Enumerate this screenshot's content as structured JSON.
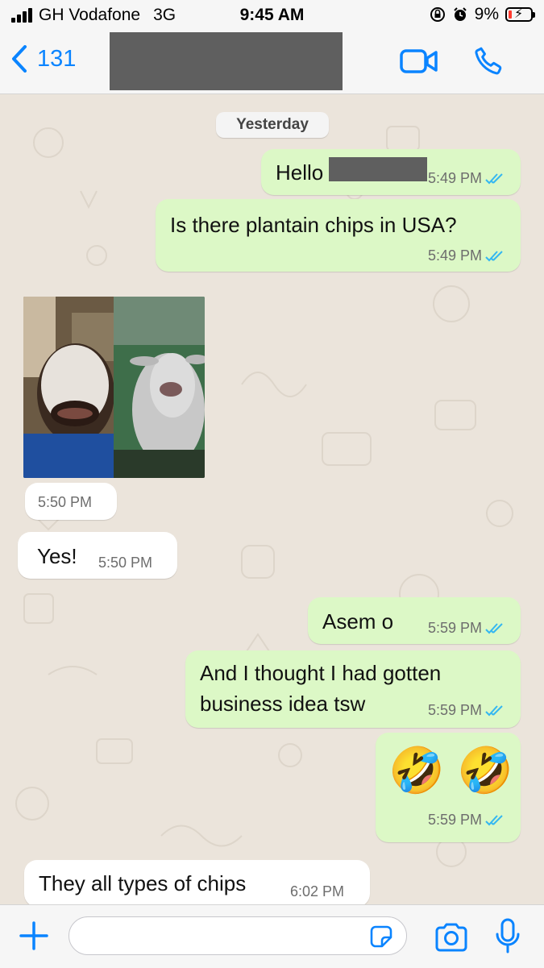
{
  "status_bar": {
    "carrier": "GH Vodafone",
    "network": "3G",
    "time": "9:45 AM",
    "battery": "9%"
  },
  "header": {
    "back_count": "131",
    "contact_name_redacted": true
  },
  "chat": {
    "date_label": "Yesterday",
    "messages": [
      {
        "direction": "out",
        "text": "Hello",
        "time": "5:49 PM",
        "read": true
      },
      {
        "direction": "out",
        "text": "Is there plantain chips in USA?",
        "time": "5:49 PM",
        "read": true
      },
      {
        "direction": "in",
        "type": "image",
        "time": "5:50 PM"
      },
      {
        "direction": "in",
        "text": "Yes!",
        "time": "5:50 PM"
      },
      {
        "direction": "out",
        "text": "Asem o",
        "time": "5:59 PM",
        "read": true
      },
      {
        "direction": "out",
        "lines": [
          "And I thought I had gotten",
          "business idea tsw"
        ],
        "time": "5:59 PM",
        "read": true
      },
      {
        "direction": "out",
        "text": "🤣 🤣",
        "time": "5:59 PM",
        "read": true
      },
      {
        "direction": "in",
        "text": "They all types of chips",
        "time": "6:02 PM"
      }
    ]
  },
  "colors": {
    "outgoing_bubble": "#dcf8c6",
    "incoming_bubble": "#ffffff",
    "chat_background": "#ebe4db",
    "accent": "#0a84ff",
    "read_ticks": "#34b7f1"
  }
}
